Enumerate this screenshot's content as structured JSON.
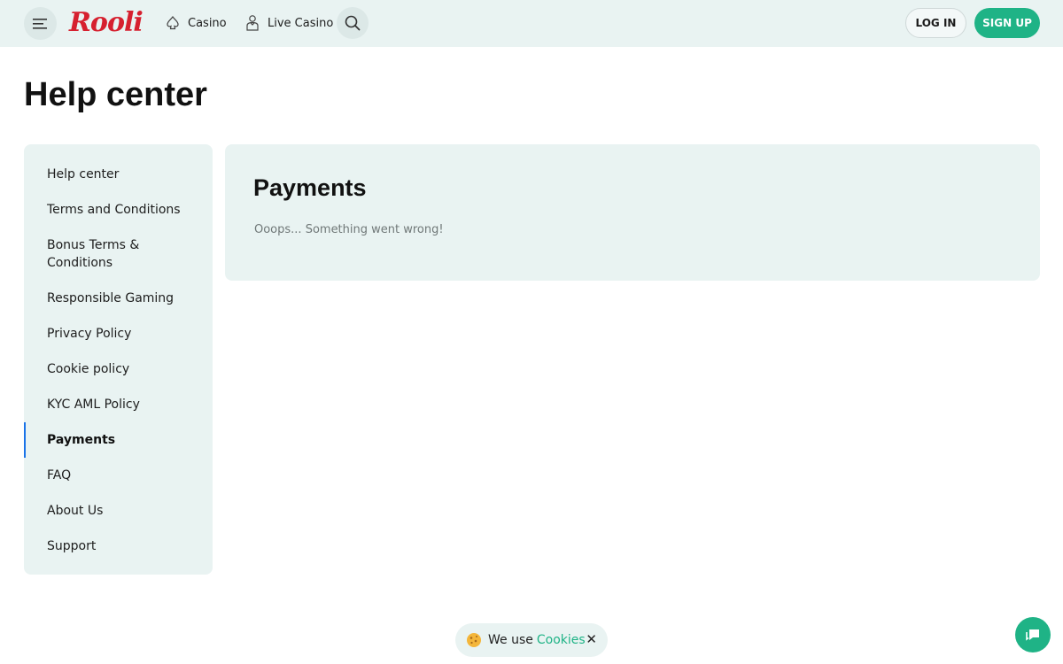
{
  "header": {
    "brand": "Rooli",
    "nav": {
      "casino_label": "Casino",
      "live_casino_label": "Live Casino"
    },
    "login_label": "LOG IN",
    "signup_label": "SIGN UP"
  },
  "page": {
    "title": "Help center"
  },
  "sidebar": {
    "items": [
      {
        "label": "Help center"
      },
      {
        "label": "Terms and Conditions"
      },
      {
        "label": "Bonus Terms & Conditions"
      },
      {
        "label": "Responsible Gaming"
      },
      {
        "label": "Privacy Policy"
      },
      {
        "label": "Cookie policy"
      },
      {
        "label": "KYC AML Policy"
      },
      {
        "label": "Payments"
      },
      {
        "label": "FAQ"
      },
      {
        "label": "About Us"
      },
      {
        "label": "Support"
      }
    ],
    "active": "Payments"
  },
  "content": {
    "title": "Payments",
    "message": "Ooops... Something went wrong!"
  },
  "cookie_bar": {
    "text": "We use",
    "link": "Cookies",
    "close": "✕"
  },
  "colors": {
    "accent": "#1fb386",
    "brand": "#d6202f",
    "panel": "#e9f3f2",
    "active_indicator": "#1a73e8"
  }
}
